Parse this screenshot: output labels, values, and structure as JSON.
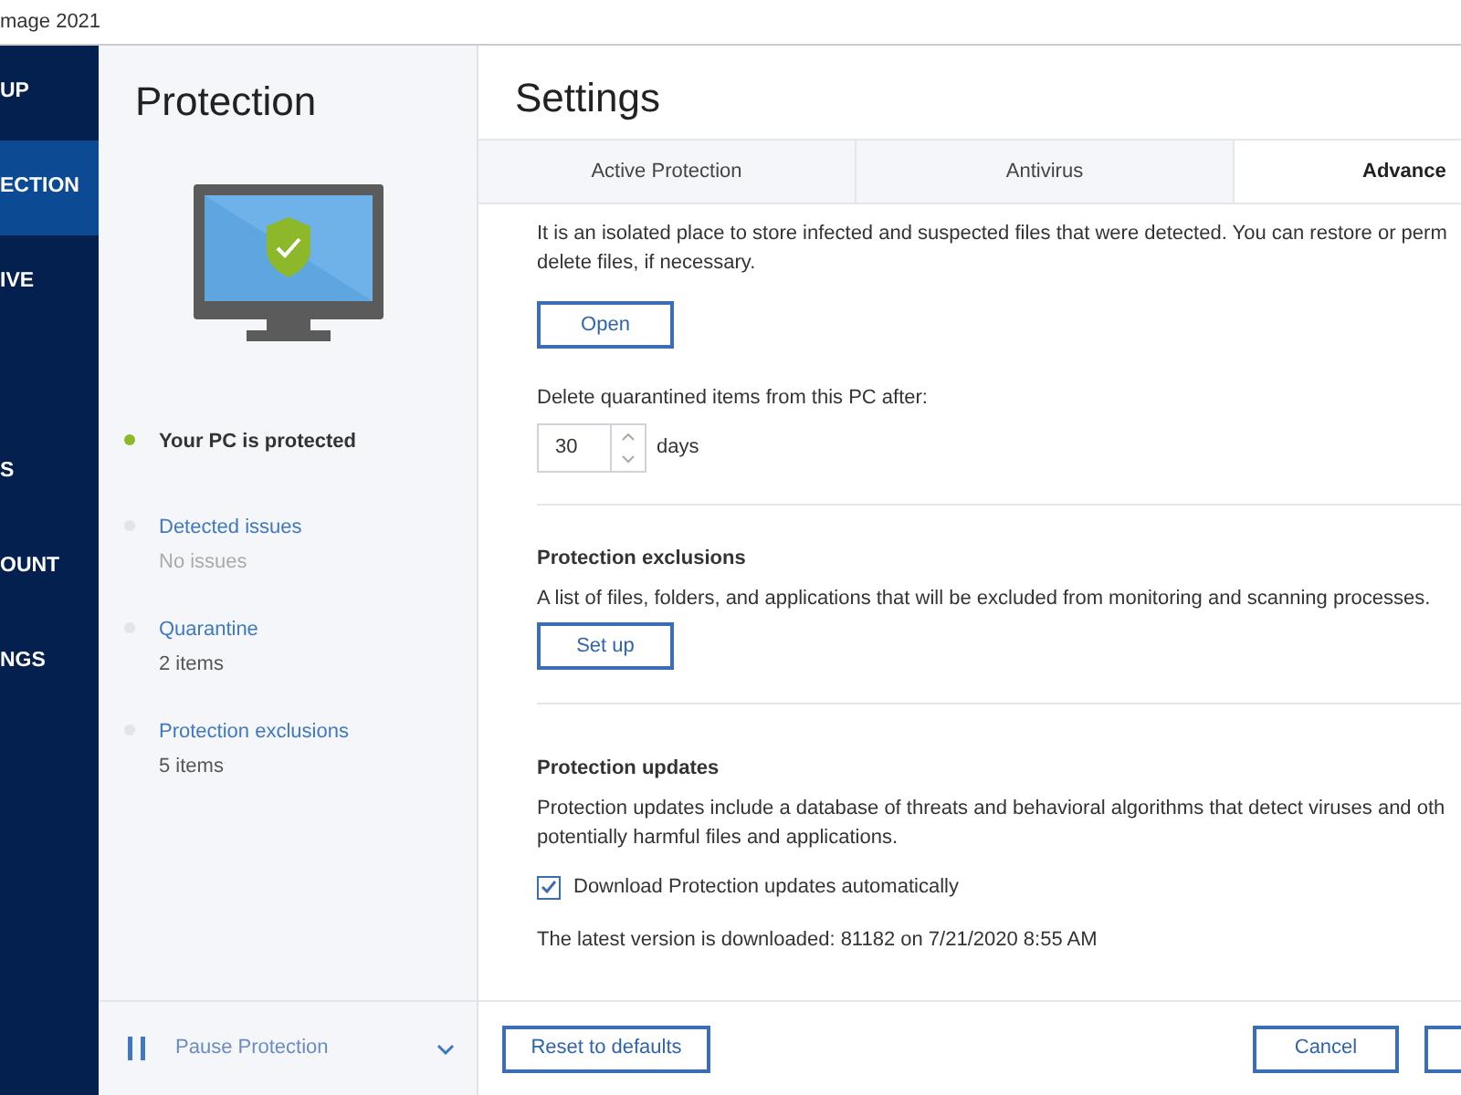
{
  "window": {
    "title": "mage 2021"
  },
  "sidebar": {
    "items": [
      {
        "label": "UP",
        "selected": false
      },
      {
        "label": "ECTION",
        "selected": true
      },
      {
        "label": "IVE",
        "selected": false
      },
      {
        "label": "S",
        "selected": false
      },
      {
        "label": "OUNT",
        "selected": false
      },
      {
        "label": "NGS",
        "selected": false
      }
    ]
  },
  "protection_panel": {
    "title": "Protection",
    "status": {
      "label": "Your PC is protected",
      "color": "#8cb82a"
    },
    "items": [
      {
        "title": "Detected issues",
        "detail": "No issues",
        "color": "#e1e4e8"
      },
      {
        "title": "Quarantine",
        "detail": "2 items",
        "color": "#e1e4e8"
      },
      {
        "title": "Protection exclusions",
        "detail": "5 items",
        "color": "#e1e4e8"
      }
    ],
    "pause": {
      "label": "Pause Protection"
    }
  },
  "settings": {
    "title": "Settings",
    "tabs": [
      {
        "label": "Active Protection",
        "selected": false
      },
      {
        "label": "Antivirus",
        "selected": false
      },
      {
        "label": "Advance",
        "selected": true
      }
    ],
    "quarantine": {
      "description": "It is an isolated place to store infected and suspected files that were detected. You can restore or perm",
      "description_line_2": "delete files, if necessary.",
      "button": "Open",
      "delete_label": "Delete quarantined items from this PC after:",
      "days_value": "30",
      "days_unit": "days"
    },
    "exclusions": {
      "title": "Protection exclusions",
      "description": "A list of files, folders, and applications that will be excluded from monitoring and scanning processes.",
      "button": "Set up"
    },
    "updates": {
      "title": "Protection updates",
      "description": "Protection updates include a database of threats and behavioral algorithms that detect viruses and oth",
      "description_line_2": "potentially harmful files and applications.",
      "checkbox": {
        "label": "Download Protection updates automatically",
        "checked": true
      },
      "latest": "The latest version is downloaded: 81182 on 7/21/2020 8:55 AM"
    },
    "footer": {
      "reset": "Reset to defaults",
      "cancel": "Cancel"
    }
  }
}
